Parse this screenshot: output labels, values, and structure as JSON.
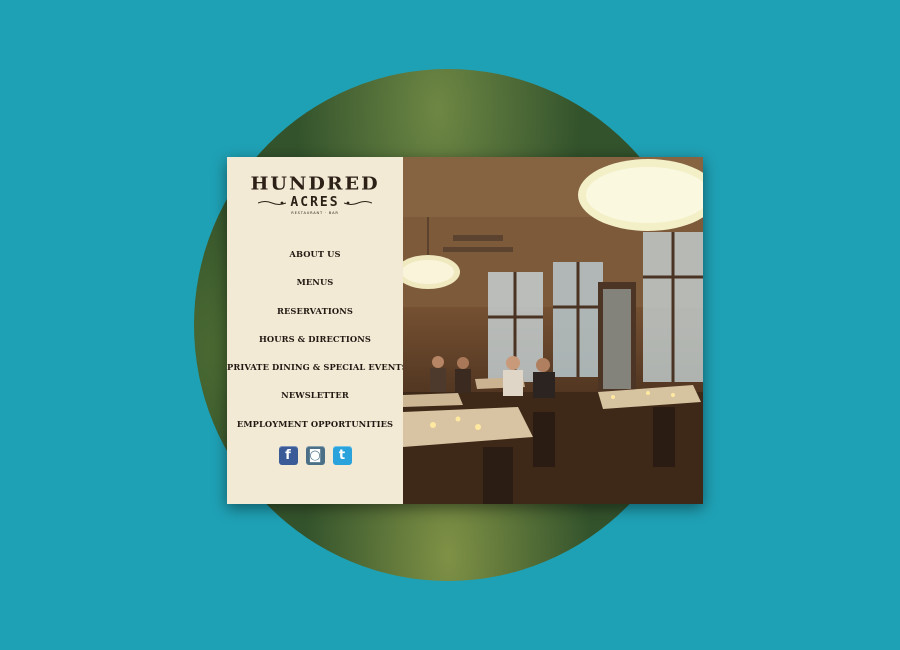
{
  "brand": {
    "name": "HUNDRED",
    "sub": "ACRES",
    "tagline": "RESTAURANT · BAR"
  },
  "nav": {
    "items": [
      {
        "label": "ABOUT US"
      },
      {
        "label": "MENUS"
      },
      {
        "label": "RESERVATIONS"
      },
      {
        "label": "HOURS & DIRECTIONS"
      },
      {
        "label": "PRIVATE DINING & SPECIAL EVENTS"
      },
      {
        "label": "NEWSLETTER"
      },
      {
        "label": "EMPLOYMENT OPPORTUNITIES"
      }
    ]
  },
  "social": [
    {
      "icon": "facebook-icon",
      "glyph": "f"
    },
    {
      "icon": "instagram-icon",
      "glyph": "◙"
    },
    {
      "icon": "twitter-icon",
      "glyph": "t"
    }
  ],
  "colors": {
    "background": "#1fa1b5",
    "panel": "#f3ead6",
    "text": "#221a12"
  }
}
